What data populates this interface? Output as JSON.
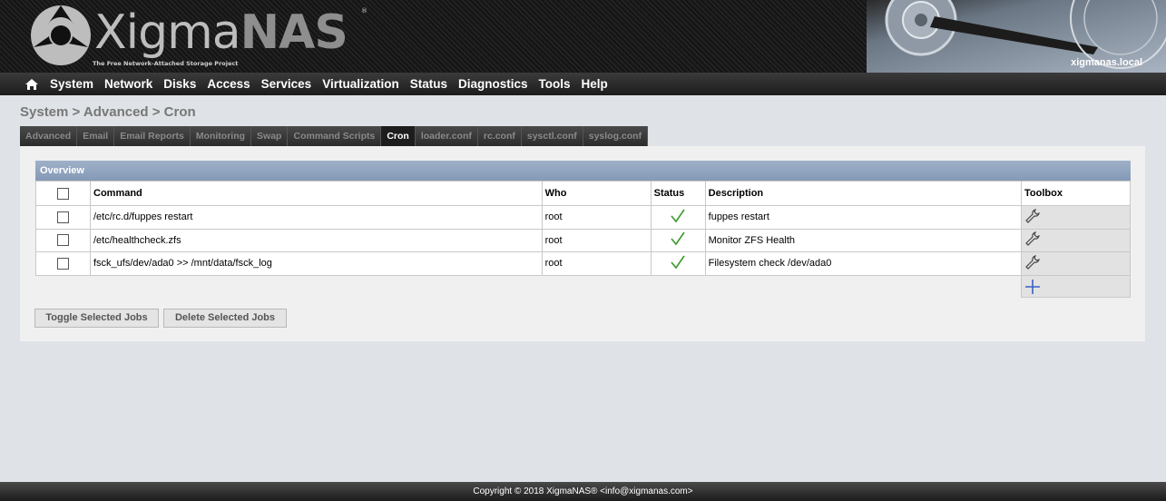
{
  "header": {
    "logo_text_a": "Xigma",
    "logo_text_b": "NAS",
    "logo_reg": "®",
    "logo_subtitle": "The Free Network-Attached Storage Project",
    "hostname": "xigmanas.local"
  },
  "nav": {
    "items": [
      "System",
      "Network",
      "Disks",
      "Access",
      "Services",
      "Virtualization",
      "Status",
      "Diagnostics",
      "Tools",
      "Help"
    ]
  },
  "breadcrumb": "System > Advanced > Cron",
  "tabs": [
    {
      "label": "Advanced",
      "active": false
    },
    {
      "label": "Email",
      "active": false
    },
    {
      "label": "Email Reports",
      "active": false
    },
    {
      "label": "Monitoring",
      "active": false
    },
    {
      "label": "Swap",
      "active": false
    },
    {
      "label": "Command Scripts",
      "active": false
    },
    {
      "label": "Cron",
      "active": true
    },
    {
      "label": "loader.conf",
      "active": false
    },
    {
      "label": "rc.conf",
      "active": false
    },
    {
      "label": "sysctl.conf",
      "active": false
    },
    {
      "label": "syslog.conf",
      "active": false
    }
  ],
  "overview": {
    "title": "Overview",
    "columns": [
      "Command",
      "Who",
      "Status",
      "Description",
      "Toolbox"
    ],
    "rows": [
      {
        "command": "/etc/rc.d/fuppes restart",
        "who": "root",
        "status_icon": "check-icon",
        "description": "fuppes restart"
      },
      {
        "command": "/etc/healthcheck.zfs",
        "who": "root",
        "status_icon": "check-icon",
        "description": "Monitor ZFS Health"
      },
      {
        "command": "fsck_ufs/dev/ada0 >> /mnt/data/fsck_log",
        "who": "root",
        "status_icon": "check-icon",
        "description": "Filesystem check /dev/ada0"
      }
    ]
  },
  "buttons": {
    "toggle": "Toggle Selected Jobs",
    "delete": "Delete Selected Jobs"
  },
  "footer": "Copyright © 2018 XigmaNAS® <info@xigmanas.com>",
  "colors": {
    "accent": "#8499b6",
    "check": "#3a9a2a",
    "add": "#3a5fc8"
  }
}
